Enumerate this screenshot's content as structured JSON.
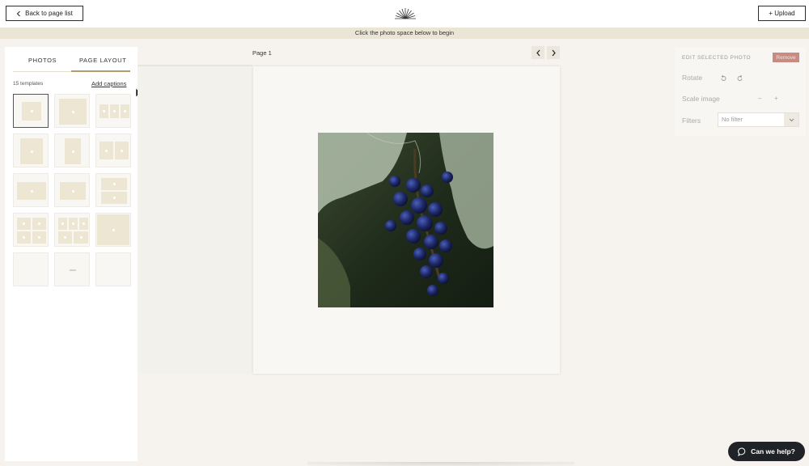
{
  "header": {
    "back_label": "Back to page list",
    "upload_label": "+ Upload",
    "logo_icon": "sunburst-logo-icon"
  },
  "banner": {
    "text": "Click the photo space below to begin"
  },
  "left_panel": {
    "tabs": [
      {
        "label": "PHOTOS",
        "active": false
      },
      {
        "label": "PAGE LAYOUT",
        "active": true
      }
    ],
    "template_count": "15 templates",
    "add_captions": "Add captions",
    "templates_selected_index": 0
  },
  "canvas": {
    "page_label": "Page 1",
    "prev_icon": "chevron-left-icon",
    "next_icon": "chevron-right-icon"
  },
  "right_panel": {
    "title": "EDIT SELECTED PHOTO",
    "remove_label": "Remove",
    "rotate_label": "Rotate",
    "scale_label": "Scale image",
    "scale_minus": "–",
    "scale_plus": "+",
    "filters_label": "Filters",
    "filter_value": "No filter"
  },
  "help": {
    "label": "Can we help?"
  },
  "colors": {
    "accent": "#b59a6c",
    "banner": "#ebe5d6",
    "remove": "#c98a82",
    "help_bg": "#1f2327"
  }
}
